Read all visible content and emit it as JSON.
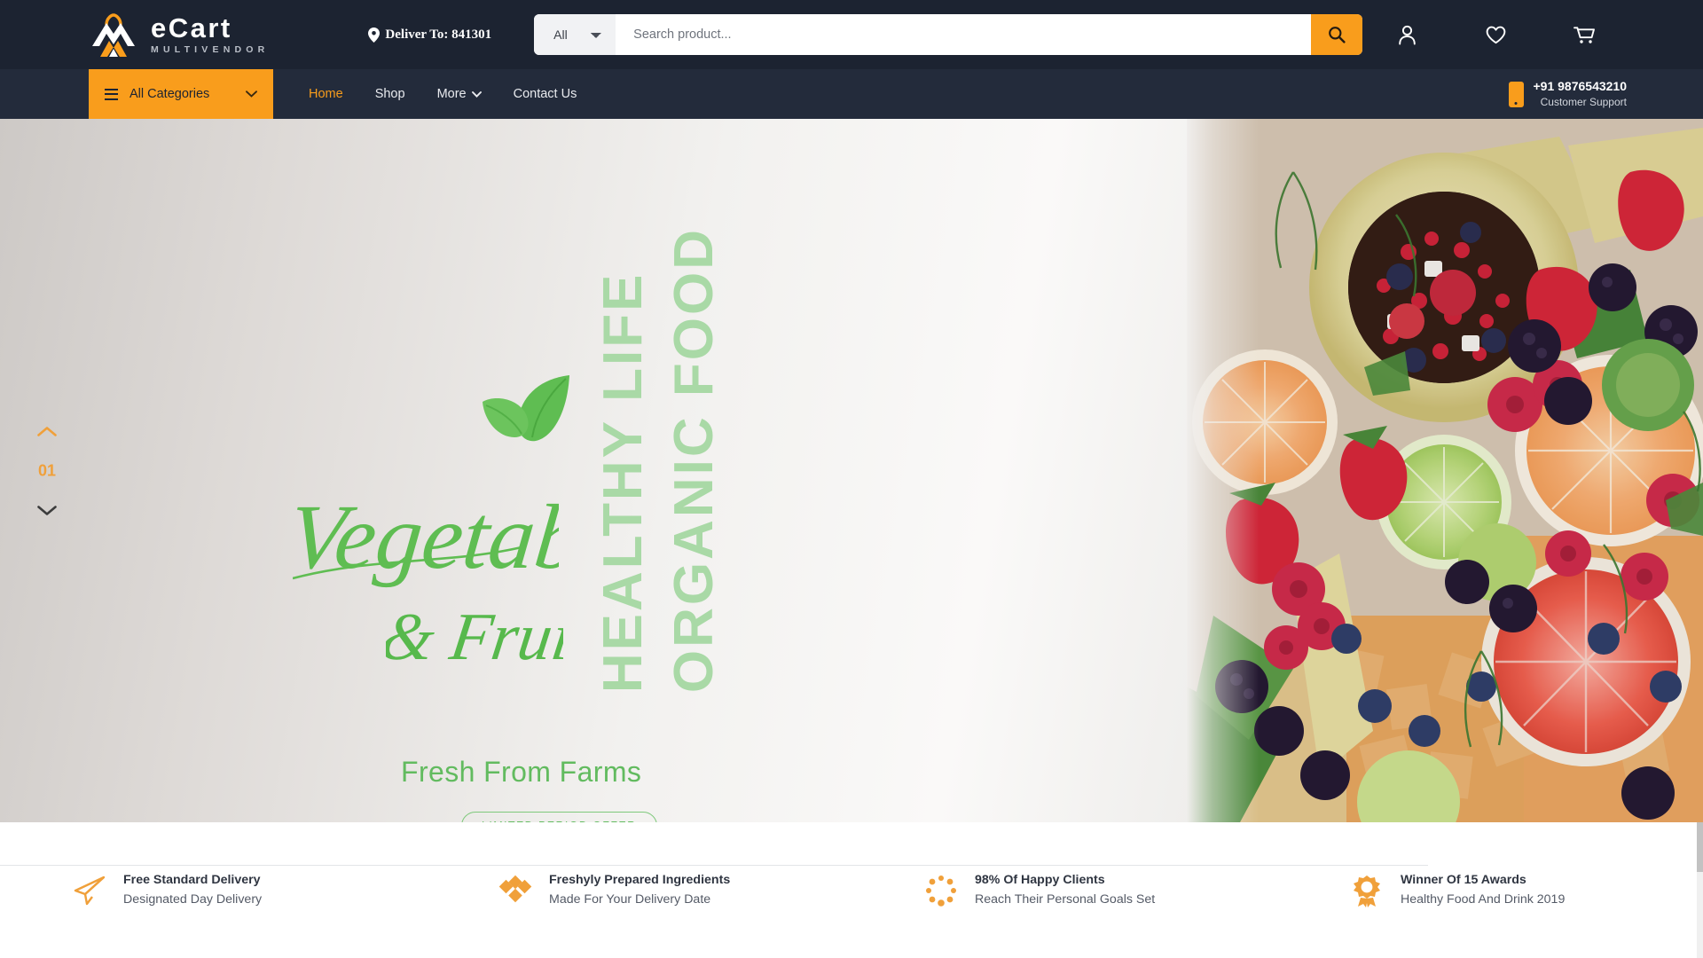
{
  "brand": {
    "name": "eCart",
    "tagline": "MULTIVENDOR",
    "logo_icon": "shopping-bag-mountain-logo",
    "accent_color": "#f99d1c",
    "header_bg": "#1c2331",
    "nav_bg": "#232b3b"
  },
  "header": {
    "deliver_label": "Deliver To: 841301",
    "location_icon": "map-pin-icon",
    "search": {
      "category_selected": "All",
      "category_options": [
        "All"
      ],
      "placeholder": "Search product...",
      "value": "",
      "button_icon": "search-icon"
    },
    "icons": [
      {
        "name": "account-icon",
        "glyph": "user"
      },
      {
        "name": "wishlist-icon",
        "glyph": "heart"
      },
      {
        "name": "cart-icon",
        "glyph": "shopping-cart"
      }
    ]
  },
  "nav": {
    "categories_label": "All Categories",
    "categories_icon": "hamburger-icon",
    "categories_chevron": "chevron-down-icon",
    "links": [
      {
        "label": "Home",
        "active": true,
        "has_chevron": false
      },
      {
        "label": "Shop",
        "active": false,
        "has_chevron": false
      },
      {
        "label": "More",
        "active": false,
        "has_chevron": true
      },
      {
        "label": "Contact Us",
        "active": false,
        "has_chevron": false
      }
    ],
    "support": {
      "icon": "mobile-phone-icon",
      "number": "+91 9876543210",
      "label": "Customer Support"
    }
  },
  "hero": {
    "slider": {
      "up_icon": "chevron-up-icon",
      "slide_number": "01",
      "down_icon": "chevron-down-icon"
    },
    "script_title": "Vegetable",
    "script_subtitle": "& Fruits",
    "vertical_words": [
      "HEALTHY LIFE",
      "ORGANIC FOOD"
    ],
    "subheading": "Fresh From Farms",
    "offer_button": "LIMITED PERIOD OFFER",
    "leaf_icon": "leaf-icon",
    "image_alt": "fruit-platter-photo",
    "green_color": "#62bb5f",
    "pale_green_color": "#a9d9a6"
  },
  "features": [
    {
      "icon": "paper-plane-icon",
      "title": "Free Standard Delivery",
      "subtitle": "Designated Day Delivery"
    },
    {
      "icon": "diamonds-icon",
      "title": "Freshyly Prepared Ingredients",
      "subtitle": "Made For Your Delivery Date"
    },
    {
      "icon": "dotted-circle-icon",
      "title": "98% Of Happy Clients",
      "subtitle": "Reach Their Personal Goals Set"
    },
    {
      "icon": "award-medal-icon",
      "title": "Winner Of 15 Awards",
      "subtitle": "Healthy Food And Drink 2019"
    }
  ]
}
